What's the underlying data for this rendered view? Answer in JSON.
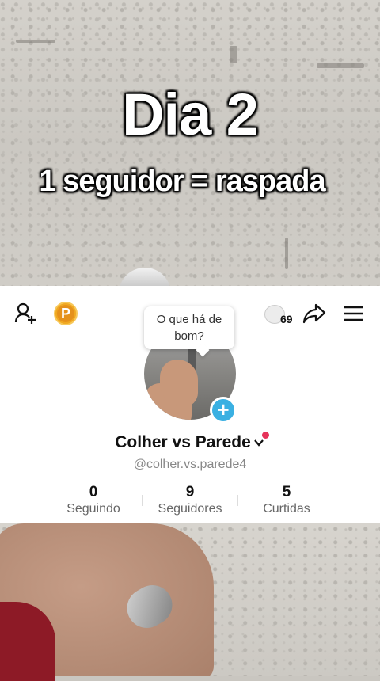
{
  "video": {
    "overlay_title": "Dia 2",
    "overlay_subtitle": "1 seguidor = raspada"
  },
  "profile": {
    "views_count": "69",
    "bubble_text": "O que há de bom?",
    "display_name": "Colher vs Parede",
    "username": "@colher.vs.parede4",
    "stats": [
      {
        "value": "0",
        "label": "Seguindo"
      },
      {
        "value": "9",
        "label": "Seguidores"
      },
      {
        "value": "5",
        "label": "Curtidas"
      }
    ],
    "coin_letter": "P"
  },
  "colors": {
    "accent_blue": "#3ab0e2",
    "coin": "#f0a821",
    "notification_dot": "#e6335a"
  }
}
